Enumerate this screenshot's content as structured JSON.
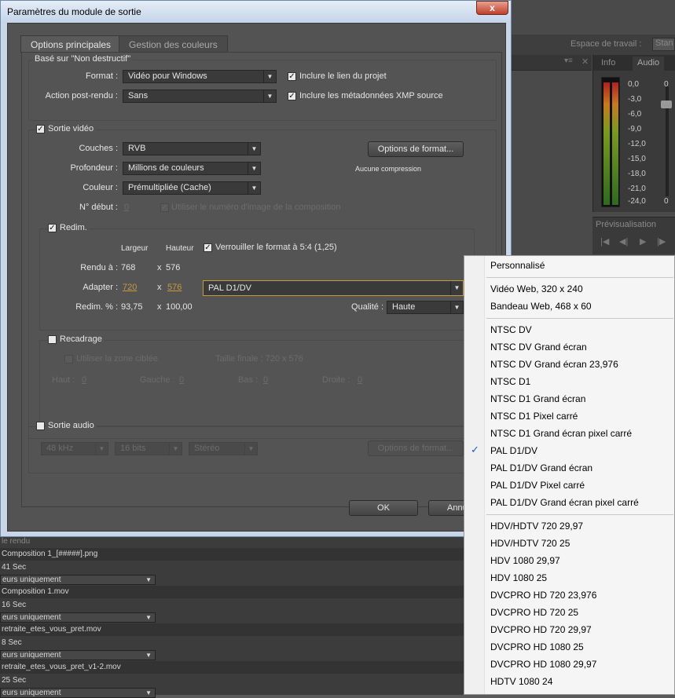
{
  "background": {
    "workspace_label": "Espace de travail :",
    "workspace_value": "Stan",
    "panel_tabs": [
      "Info",
      "Audio"
    ],
    "audio_levels": [
      "0,0",
      "-3,0",
      "-6,0",
      "-9,0",
      "-12,0",
      "-15,0",
      "-18,0",
      "-21,0",
      "-24,0"
    ],
    "audio_right_labels": [
      "0",
      "0"
    ],
    "preview_title": "Prévisualisation",
    "render_queue": {
      "header": "le rendu",
      "rows": [
        {
          "text": "Composition 1_[#####].png",
          "type": "file"
        },
        {
          "text": "41 Sec",
          "type": "time"
        },
        {
          "text": "eurs uniquement",
          "type": "select"
        },
        {
          "text": "Composition 1.mov",
          "type": "file"
        },
        {
          "text": "16 Sec",
          "type": "time"
        },
        {
          "text": "eurs uniquement",
          "type": "select"
        },
        {
          "text": "retraite_etes_vous_pret.mov",
          "type": "file"
        },
        {
          "text": "8 Sec",
          "type": "time"
        },
        {
          "text": "eurs uniquement",
          "type": "select"
        },
        {
          "text": "retraite_etes_vous_pret_v1-2.mov",
          "type": "file"
        },
        {
          "text": "25 Sec",
          "type": "time"
        },
        {
          "text": "eurs uniquement",
          "type": "select"
        }
      ]
    }
  },
  "dialog": {
    "title": "Paramètres du module de sortie",
    "close": "x",
    "tabs": [
      "Options principales",
      "Gestion des couleurs"
    ],
    "based_on": "Basé sur \"Non destructif\"",
    "format_label": "Format :",
    "format_value": "Vidéo pour Windows",
    "post_render_label": "Action post-rendu :",
    "post_render_value": "Sans",
    "include_project_link": "Inclure le lien du projet",
    "include_xmp": "Inclure les métadonnées XMP source",
    "video_output": {
      "label": "Sortie vidéo",
      "channels_label": "Couches :",
      "channels_value": "RVB",
      "depth_label": "Profondeur :",
      "depth_value": "Millions de couleurs",
      "color_label": "Couleur :",
      "color_value": "Prémultipliée (Cache)",
      "start_label": "N° début :",
      "start_value": "0",
      "use_comp_frame": "Utiliser le numéro d'image de la composition",
      "format_options_button": "Options de format...",
      "compression_note": "Aucune compression"
    },
    "resize": {
      "label": "Redim.",
      "width_hdr": "Largeur",
      "height_hdr": "Hauteur",
      "lock_ratio": "Verrouiller le format à 5:4 (1,25)",
      "render_label": "Rendu à :",
      "render_w": "768",
      "render_h": "576",
      "adapt_label": "Adapter :",
      "adapt_w": "720",
      "adapt_h": "576",
      "preset_value": "PAL D1/DV",
      "pct_label": "Redim. % :",
      "pct_w": "93,75",
      "pct_h": "100,00",
      "x": "x",
      "quality_label": "Qualité :",
      "quality_value": "Haute"
    },
    "crop": {
      "label": "Recadrage",
      "use_roi": "Utiliser la zone ciblée",
      "final_size": "Taille finale : 720 x 576",
      "top_label": "Haut :",
      "top_value": "0",
      "left_label": "Gauche :",
      "left_value": "0",
      "bottom_label": "Bas :",
      "bottom_value": "0",
      "right_label": "Droite :",
      "right_value": "0"
    },
    "audio_output": {
      "label": "Sortie audio",
      "rate": "48 kHz",
      "bits": "16 bits",
      "channels": "Stéréo",
      "format_options_button": "Options de format..."
    },
    "ok": "OK",
    "cancel": "Annu"
  },
  "menu": {
    "selected": "PAL D1/DV",
    "check": "✓",
    "items": [
      "Personnalisé",
      "Vidéo Web, 320 x 240",
      "Bandeau Web, 468 x 60",
      "NTSC DV",
      "NTSC DV Grand écran",
      "NTSC DV Grand écran 23,976",
      "NTSC D1",
      "NTSC D1 Grand écran",
      "NTSC D1 Pixel carré",
      "NTSC D1 Grand écran pixel carré",
      "PAL D1/DV",
      "PAL D1/DV Grand écran",
      "PAL D1/DV Pixel carré",
      "PAL D1/DV Grand écran pixel carré",
      "HDV/HDTV 720 29,97",
      "HDV/HDTV 720 25",
      "HDV 1080 29,97",
      "HDV 1080 25",
      "DVCPRO HD 720 23,976",
      "DVCPRO HD 720 25",
      "DVCPRO HD 720 29,97",
      "DVCPRO HD 1080 25",
      "DVCPRO HD 1080 29,97",
      "HDTV 1080 24"
    ]
  }
}
